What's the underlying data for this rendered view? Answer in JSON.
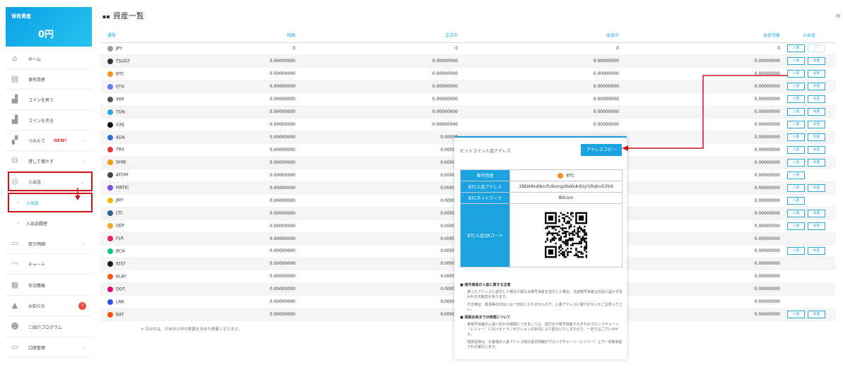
{
  "sidebar": {
    "assets_label": "保有資産",
    "assets_value": "0円",
    "items": [
      {
        "label": "ホーム",
        "icon": "home-icon",
        "glyph": "⌂"
      },
      {
        "label": "保有資産",
        "icon": "wallet-icon",
        "glyph": "▤"
      },
      {
        "label": "コインを買う",
        "icon": "buy-icon",
        "glyph": "▟"
      },
      {
        "label": "コインを売る",
        "icon": "sell-icon",
        "glyph": "▟"
      },
      {
        "label": "つみたて",
        "icon": "savings-icon",
        "glyph": "▞",
        "badge_new": "NEW!"
      },
      {
        "label": "貸して増やす",
        "icon": "lend-icon",
        "glyph": "⛁"
      },
      {
        "label": "入出金",
        "icon": "deposit-icon",
        "glyph": "◎"
      }
    ],
    "sub_items": [
      {
        "label": "入出金"
      },
      {
        "label": "入出金履歴"
      }
    ],
    "items2": [
      {
        "label": "取引明細",
        "icon": "document-icon",
        "glyph": "▭"
      },
      {
        "label": "チャート",
        "icon": "chart-icon",
        "glyph": "〰"
      },
      {
        "label": "市況情報",
        "icon": "news-icon",
        "glyph": "▦"
      },
      {
        "label": "お知らせ",
        "icon": "bell-icon",
        "glyph": "▲",
        "badge": "3"
      },
      {
        "label": "ご紹介プログラム",
        "icon": "referral-icon",
        "glyph": "☻"
      },
      {
        "label": "口座管理",
        "icon": "account-icon",
        "glyph": "▭"
      }
    ]
  },
  "page": {
    "title": "資産一覧",
    "corner_text": "同"
  },
  "table": {
    "headers": [
      "通貨",
      "残高",
      "注文中",
      "出金中",
      "出金可能",
      "入出金"
    ],
    "deposit_label": "入金",
    "withdraw_label": "出金",
    "rows": [
      {
        "sym": "JPY",
        "color": "#9e9e9e",
        "bal": "0",
        "ord": "0",
        "wd": "0",
        "avail": "0",
        "dep": true,
        "wdr": true,
        "wd_disabled": true
      },
      {
        "sym": "TSUGT",
        "color": "#333333",
        "bal": "0.00000000",
        "ord": "0.00000000",
        "wd": "0.00000000",
        "avail": "0.00000000",
        "dep": true,
        "wdr": true
      },
      {
        "sym": "BTC",
        "color": "#f7931a",
        "bal": "0.00000000",
        "ord": "0.00000000",
        "wd": "0.00000000",
        "avail": "0.00000000",
        "dep": true,
        "wdr": true
      },
      {
        "sym": "ETH",
        "color": "#627eea",
        "bal": "0.00000000",
        "ord": "0.00000000",
        "wd": "0.00000000",
        "avail": "0.00000000",
        "dep": true,
        "wdr": true
      },
      {
        "sym": "XRP",
        "color": "#555555",
        "bal": "0.00000000",
        "ord": "0.00000000",
        "wd": "0.00000000",
        "avail": "0.00000000",
        "dep": true,
        "wdr": true
      },
      {
        "sym": "TON",
        "color": "#2aa8e0",
        "bal": "0.00000000",
        "ord": "0.00000000",
        "wd": "0.00000000",
        "avail": "0.00000000",
        "dep": true,
        "wdr": true
      },
      {
        "sym": "GXE",
        "color": "#111111",
        "bal": "0.00000000",
        "ord": "0.00000000",
        "wd": "0.00000000",
        "avail": "0.00000000",
        "dep": true,
        "wdr": true
      },
      {
        "sym": "ADA",
        "color": "#2a71d0",
        "bal": "0.00000000",
        "ord": "0.00000",
        "wd": "",
        "avail": "0.00000000",
        "dep": true,
        "wdr": true
      },
      {
        "sym": "TRX",
        "color": "#e53935",
        "bal": "0.00000000",
        "ord": "0.00000",
        "wd": "",
        "avail": "0.00000000",
        "dep": true,
        "wdr": true
      },
      {
        "sym": "SHIB",
        "color": "#f29f05",
        "bal": "0.00000000",
        "ord": "0.00000",
        "wd": "",
        "avail": "0.00000000",
        "dep": true,
        "wdr": true
      },
      {
        "sym": "ATOM",
        "color": "#444444",
        "bal": "0.00000000",
        "ord": "0.00000",
        "wd": "",
        "avail": "0.00000000",
        "dep": true,
        "wdr": false
      },
      {
        "sym": "MATIC",
        "color": "#8247e5",
        "bal": "0.00000000",
        "ord": "0.00000",
        "wd": "",
        "avail": "0.00000000",
        "dep": true,
        "wdr": true
      },
      {
        "sym": "JMY",
        "color": "#f2b705",
        "bal": "0.00000000",
        "ord": "0.00000",
        "wd": "",
        "avail": "0.00000000",
        "dep": true,
        "wdr": false
      },
      {
        "sym": "LTC",
        "color": "#345d9d",
        "bal": "0.00000000",
        "ord": "0.00000",
        "wd": "",
        "avail": "0.00000000",
        "dep": true,
        "wdr": true
      },
      {
        "sym": "DEP",
        "color": "#f5a623",
        "bal": "0.00000000",
        "ord": "0.00000",
        "wd": "",
        "avail": "0.00000000",
        "dep": true,
        "wdr": true
      },
      {
        "sym": "FLR",
        "color": "#e91e63",
        "bal": "0.00000000",
        "ord": "0.00000",
        "wd": "",
        "avail": "0.00000000",
        "dep": false,
        "wdr": false
      },
      {
        "sym": "BCH",
        "color": "#0ac18e",
        "bal": "0.00000000",
        "ord": "0.00000",
        "wd": "",
        "avail": "0.00000000",
        "dep": true,
        "wdr": true
      },
      {
        "sym": "IOST",
        "color": "#1c1c1c",
        "bal": "0.00000000",
        "ord": "0.00000",
        "wd": "",
        "avail": "0.00000000",
        "dep": false,
        "wdr": false
      },
      {
        "sym": "KLAY",
        "color": "#ff5722",
        "bal": "0.00000000",
        "ord": "0.00000",
        "wd": "",
        "avail": "0.00000000",
        "dep": false,
        "wdr": false
      },
      {
        "sym": "DOT",
        "color": "#e6007a",
        "bal": "0.00000000",
        "ord": "0.00000",
        "wd": "",
        "avail": "0.00000000",
        "dep": false,
        "wdr": false
      },
      {
        "sym": "LNK",
        "color": "#2a5ada",
        "bal": "0.00000000",
        "ord": "0.00000",
        "wd": "",
        "avail": "0.00000000",
        "dep": false,
        "wdr": false
      },
      {
        "sym": "BAT",
        "color": "#ff5000",
        "bal": "0.00000000",
        "ord": "0.00000",
        "wd": "",
        "avail": "0.00000000",
        "dep": true,
        "wdr": true
      }
    ],
    "footnote": "※ 日出中は、日出中以中の数量を含めた数量となります。"
  },
  "popup": {
    "title": "ビットコイン入金アドレス",
    "copy_button": "アドレスコピー",
    "rows": [
      {
        "key": "暗号資産",
        "value": "BTC"
      },
      {
        "key": "BTC入金アドレス",
        "value": "2NDANu6bccfu9smgz9aKoKdUyl1RqhvG3Vd"
      },
      {
        "key": "BTCネットワーク",
        "value": "Bitcoin"
      },
      {
        "key": "BTC入金QRコード",
        "value": ""
      }
    ],
    "note1_title": "暗号資産の入金に関する注意",
    "note1_p1": "誤ったアドレスに送付した場合や異なる暗号資産を送付した場合、当該暗号資産は当社に届かず失われる可能性があります。",
    "note1_p2": "その場合、基源等の対応には一切応じられませんので、入金アドレスに誤りがないかご注意ください。",
    "note2_title": "残高反映までの時間について",
    "note2_p1": "各暗号資産の入金に約かる時間につきましては、送付元や暗号資産それぞれのブロックチェーン（レジャー）におけるトランザクションの状況により変化いたしますので、一定ではございません。",
    "note2_p2": "残高反映は、お客様の入金アドレス宛の送付情報がブロックチェーン（レジャー）上で一定数承認され次第行います。"
  }
}
